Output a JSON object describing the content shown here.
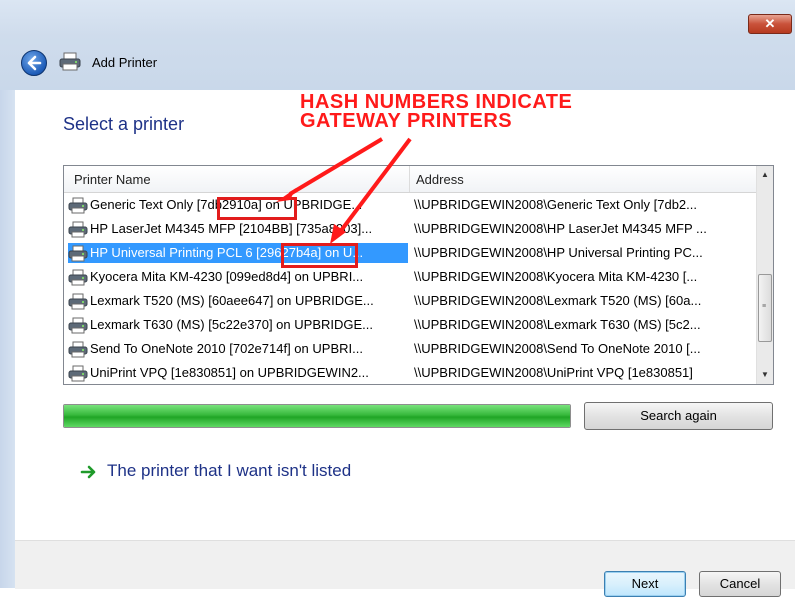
{
  "window": {
    "close_label": "✕",
    "title": "Add Printer"
  },
  "page": {
    "heading": "Select a printer"
  },
  "annotation": {
    "line1": "HASH NUMBERS INDICATE",
    "line2": "GATEWAY PRINTERS",
    "color": "#ff1a1a"
  },
  "list": {
    "headers": {
      "name": "Printer Name",
      "address": "Address"
    },
    "rows": [
      {
        "name": "Generic  Text Only [7db2910a] on UPBRIDGE...",
        "address": "\\\\UPBRIDGEWIN2008\\Generic  Text Only [7db2...",
        "selected": false
      },
      {
        "name": "HP LaserJet M4345 MFP [2104BB] [735a8903]...",
        "address": "\\\\UPBRIDGEWIN2008\\HP LaserJet M4345 MFP ...",
        "selected": false
      },
      {
        "name": "HP Universal Printing PCL 6 [29627b4a] on U...",
        "address": "\\\\UPBRIDGEWIN2008\\HP Universal Printing PC...",
        "selected": true
      },
      {
        "name": "Kyocera Mita KM-4230 [099ed8d4] on UPBRI...",
        "address": "\\\\UPBRIDGEWIN2008\\Kyocera Mita KM-4230 [...",
        "selected": false
      },
      {
        "name": "Lexmark T520 (MS) [60aee647] on UPBRIDGE...",
        "address": "\\\\UPBRIDGEWIN2008\\Lexmark T520 (MS) [60a...",
        "selected": false
      },
      {
        "name": "Lexmark T630 (MS) [5c22e370] on UPBRIDGE...",
        "address": "\\\\UPBRIDGEWIN2008\\Lexmark T630 (MS) [5c2...",
        "selected": false
      },
      {
        "name": "Send To OneNote 2010 [702e714f] on UPBRI...",
        "address": "\\\\UPBRIDGEWIN2008\\Send To OneNote 2010 [...",
        "selected": false
      },
      {
        "name": "UniPrint VPQ [1e830851] on UPBRIDGEWIN2...",
        "address": "\\\\UPBRIDGEWIN2008\\UniPrint VPQ [1e830851]",
        "selected": false
      }
    ]
  },
  "progress": {
    "value_percent": 100,
    "color": "#37b93c"
  },
  "buttons": {
    "search_again": "Search again",
    "next": "Next",
    "cancel": "Cancel"
  },
  "links": {
    "not_listed": "The printer that I want isn't listed"
  },
  "icons": {
    "back": "back-arrow-icon",
    "printer": "printer-icon",
    "link_arrow": "green-arrow-icon"
  }
}
